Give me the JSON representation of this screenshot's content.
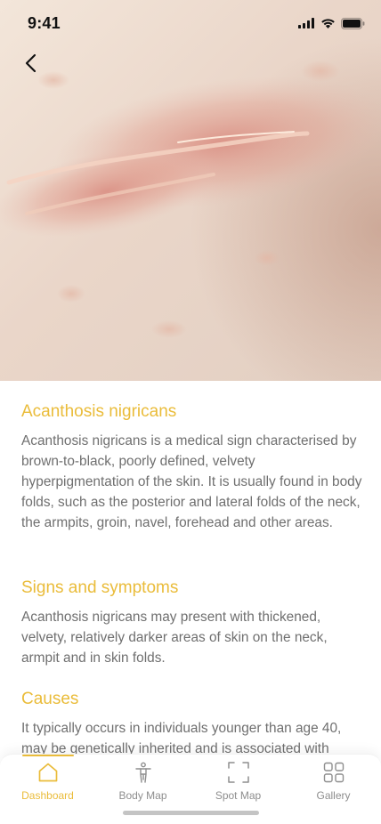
{
  "status_bar": {
    "time": "9:41"
  },
  "hero": {
    "icon": "skin-condition-photo"
  },
  "navigation": {
    "back_icon": "chevron-left-icon"
  },
  "article": {
    "sections": [
      {
        "title": "Acanthosis nigricans",
        "body": "Acanthosis nigricans is a medical sign characterised by brown-to-black, poorly defined, velvety hyperpigmentation of the skin. It is usually found in body folds, such as the posterior and lateral folds of the neck, the armpits, groin, navel, forehead and other areas."
      },
      {
        "title": "Signs and symptoms",
        "body": "Acanthosis nigricans may present with thickened, velvety, relatively darker areas of skin on the neck, armpit and in skin folds."
      },
      {
        "title": "Causes",
        "body": "It typically occurs in individuals younger than age 40, may be genetically inherited and is associated with"
      }
    ]
  },
  "tab_bar": {
    "tabs": [
      {
        "label": "Dashboard",
        "icon": "home-icon",
        "active": true
      },
      {
        "label": "Body Map",
        "icon": "body-figure-icon",
        "active": false
      },
      {
        "label": "Spot Map",
        "icon": "scan-frame-icon",
        "active": false
      },
      {
        "label": "Gallery",
        "icon": "grid-icon",
        "active": false
      }
    ]
  },
  "colors": {
    "accent": "#EABC3A",
    "body_text": "#6f6f6f",
    "inactive_tab": "#8e8e8e"
  }
}
